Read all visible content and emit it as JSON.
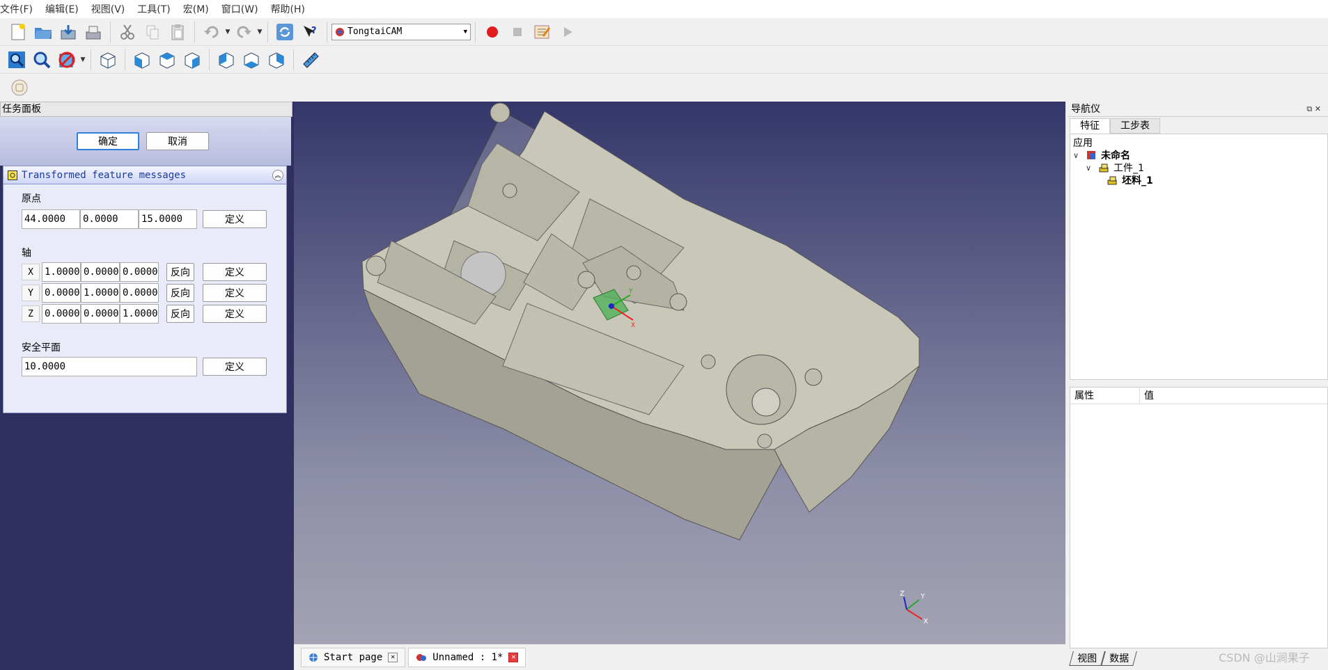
{
  "menu": [
    "文件(F)",
    "编辑(E)",
    "视图(V)",
    "工具(T)",
    "宏(M)",
    "窗口(W)",
    "帮助(H)"
  ],
  "toolbar": {
    "workbench": "TongtaiCAM",
    "icons": [
      "new-file-icon",
      "open-icon",
      "save-icon",
      "save-as-icon",
      "cut-icon",
      "copy-icon",
      "paste-icon",
      "undo-icon",
      "redo-icon",
      "refresh-icon",
      "whats-this-icon",
      "record-macro-icon",
      "stop-macro-icon",
      "edit-macro-icon",
      "run-macro-icon"
    ]
  },
  "view_toolbar": {
    "icons": [
      "fit-all-icon",
      "fit-selection-icon",
      "draw-style-icon",
      "isometric-view-icon",
      "front-view-icon",
      "top-view-icon",
      "right-view-icon",
      "rear-view-icon",
      "bottom-view-icon",
      "left-view-icon",
      "measure-icon"
    ]
  },
  "task_panel": {
    "title": "任务面板",
    "ok": "确定",
    "cancel": "取消",
    "section_title": "Transformed feature messages",
    "origin_label": "原点",
    "origin": [
      "44.0000",
      "0.0000",
      "15.0000"
    ],
    "define": "定义",
    "axis_label": "轴",
    "reverse": "反向",
    "axes": [
      {
        "name": "X",
        "values": [
          "1.0000",
          "0.0000",
          "0.0000"
        ]
      },
      {
        "name": "Y",
        "values": [
          "0.0000",
          "1.0000",
          "0.0000"
        ]
      },
      {
        "name": "Z",
        "values": [
          "0.0000",
          "0.0000",
          "1.0000"
        ]
      }
    ],
    "safe_plane_label": "安全平面",
    "safe_plane": "10.0000"
  },
  "doc_tabs": [
    {
      "label": "Start page",
      "active": false
    },
    {
      "label": "Unnamed : 1*",
      "active": true
    }
  ],
  "navigator": {
    "title": "导航仪",
    "tabs": [
      "特征",
      "工步表"
    ],
    "tree_header": "应用",
    "tree": [
      {
        "label": "未命名",
        "level": 0,
        "bold": true
      },
      {
        "label": "工件_1",
        "level": 1,
        "bold": false
      },
      {
        "label": "坯料_1",
        "level": 2,
        "bold": true
      }
    ],
    "props_cols": [
      "属性",
      "值"
    ],
    "bottom_tabs": [
      "视图",
      "数据"
    ]
  },
  "watermark": "CSDN @山涧果子",
  "colors": {
    "accent": "#2f7fd6",
    "view_top": "#34366a",
    "view_bottom": "#a3a3b4"
  }
}
